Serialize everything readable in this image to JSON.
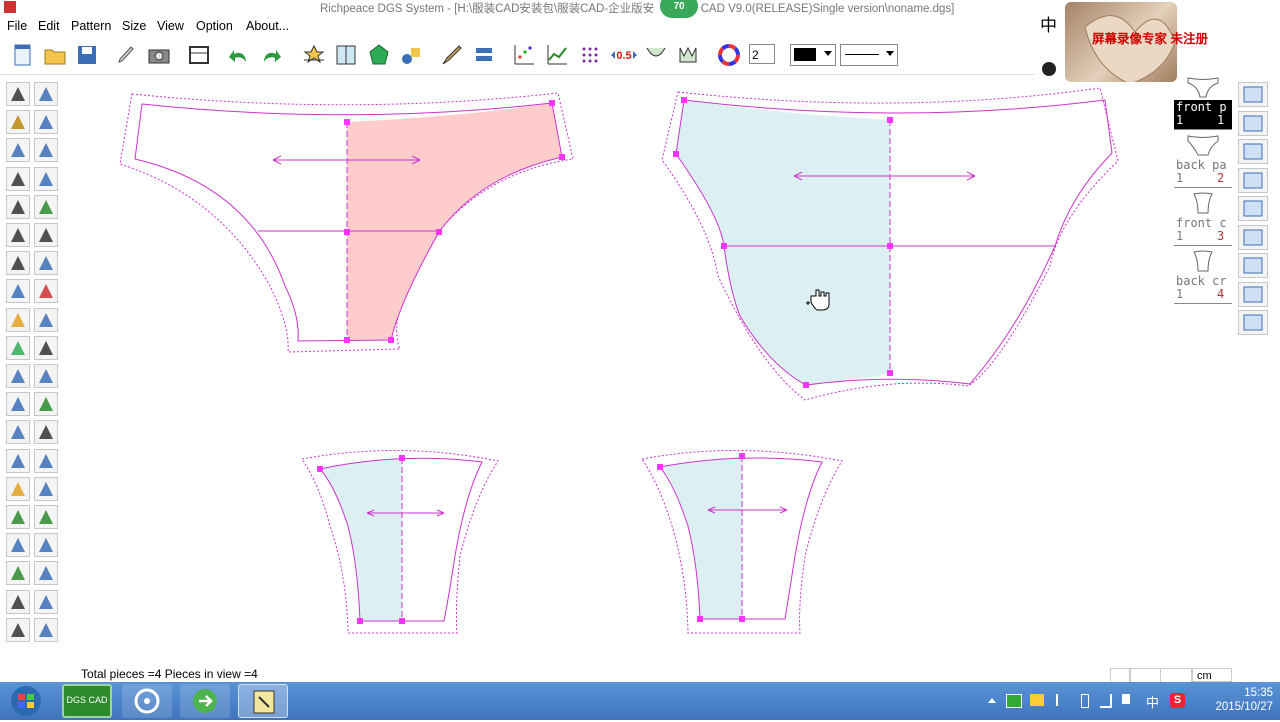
{
  "window": {
    "title": "Richpeace DGS System - [H:\\服装CAD安装包\\服装CAD-企业版安",
    "title_suffix": "CAD V9.0(RELEASE)Single version\\noname.dgs]",
    "badge": "70"
  },
  "menu": [
    "File",
    "Edit",
    "Pattern",
    "Size",
    "View",
    "Option",
    "About..."
  ],
  "toolbar": {
    "step_label": "0.5",
    "line_width_value": "2",
    "color_value": "#000000"
  },
  "pieces": [
    {
      "name": "front p",
      "index": "1",
      "number": "1",
      "active": true
    },
    {
      "name": "back pa",
      "index": "1",
      "number": "2",
      "active": false
    },
    {
      "name": "front c",
      "index": "1",
      "number": "3",
      "active": false
    },
    {
      "name": "back cr",
      "index": "1",
      "number": "4",
      "active": false
    }
  ],
  "status": {
    "summary": "Total pieces =4   Pieces in view =4",
    "unit": "cm"
  },
  "overlay": {
    "ime_char": "中",
    "watermark_text": "屏幕录像专家  未注册"
  },
  "taskbar": {
    "app_label": "DGS CAD",
    "time": "15:35",
    "date": "2015/10/27",
    "ime": "中",
    "tray_s": "S"
  },
  "colors": {
    "pattern_line": "#cc33cc",
    "front_fill": "#ffcccc",
    "back_fill": "#dcf0f3",
    "point": "#ff33ff",
    "active_piece_bg": "#000000"
  }
}
